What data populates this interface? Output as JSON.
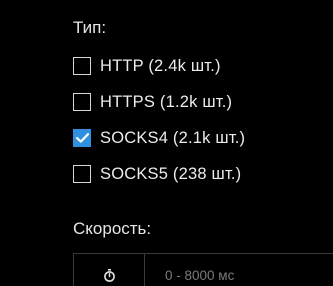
{
  "filters": {
    "type_title": "Тип:",
    "options": [
      {
        "label": "HTTP (2.4k шт.)",
        "checked": false
      },
      {
        "label": "HTTPS (1.2k шт.)",
        "checked": false
      },
      {
        "label": "SOCKS4 (2.1k шт.)",
        "checked": true
      },
      {
        "label": "SOCKS5 (238 шт.)",
        "checked": false
      }
    ],
    "speed_title": "Скорость:",
    "speed_input": {
      "placeholder": "0 - 8000 мс",
      "value": "",
      "icon": "stopwatch-icon"
    }
  },
  "colors": {
    "background": "#000000",
    "checkbox_checked": "#2f8fe0",
    "checkbox_border": "#d6d6d6",
    "text": "#ececec"
  }
}
